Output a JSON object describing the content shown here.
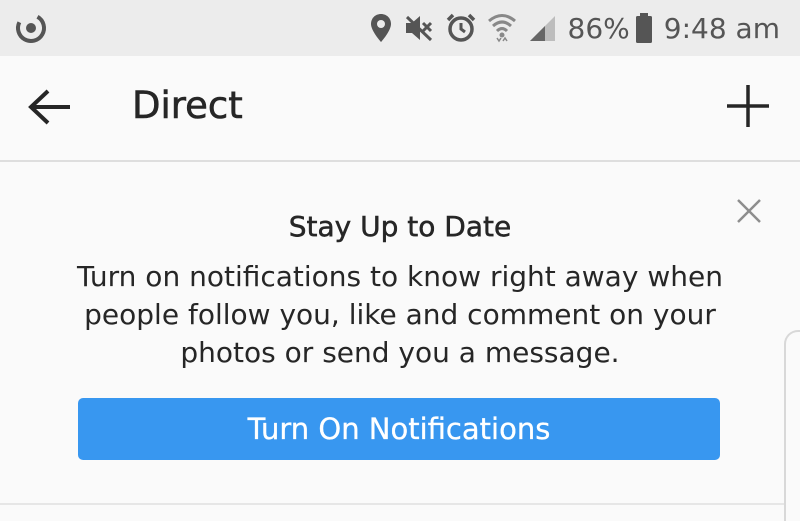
{
  "status_bar": {
    "battery_percent": "86%",
    "time": "9:48 am",
    "icons": [
      "sync-icon",
      "location-icon",
      "mute-icon",
      "alarm-icon",
      "wifi-icon",
      "signal-icon",
      "battery-icon"
    ]
  },
  "header": {
    "title": "Direct",
    "back_icon": "arrow-left-icon",
    "new_icon": "plus-icon"
  },
  "notice": {
    "title": "Stay Up to Date",
    "body": "Turn on notifications to know right away when people follow you, like and comment on your photos or send you a message.",
    "button_label": "Turn On Notifications",
    "close_icon": "close-icon"
  },
  "colors": {
    "accent": "#3897f0",
    "text": "#262626",
    "status_bar_bg": "#ececec",
    "background": "#fafafa"
  }
}
